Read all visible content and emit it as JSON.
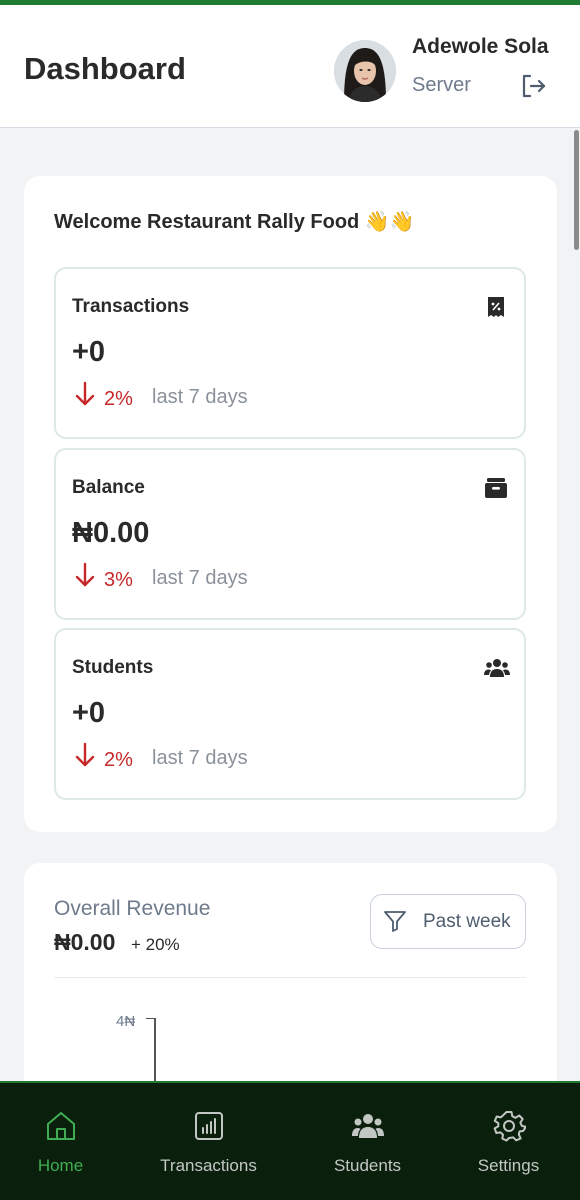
{
  "header": {
    "title": "Dashboard",
    "user_name": "Adewole Sola",
    "user_role": "Server"
  },
  "welcome": {
    "text": "Welcome Restaurant Rally Food 👋👋"
  },
  "stats": [
    {
      "title": "Transactions",
      "value": "+0",
      "change": "2%",
      "period": "last 7 days",
      "icon": "receipt-icon"
    },
    {
      "title": "Balance",
      "value": "₦0.00",
      "change": "3%",
      "period": "last 7 days",
      "icon": "wallet-icon"
    },
    {
      "title": "Students",
      "value": "+0",
      "change": "2%",
      "period": "last 7 days",
      "icon": "users-icon"
    }
  ],
  "revenue": {
    "title": "Overall Revenue",
    "value": "₦0.00",
    "change": "+ 20%",
    "filter_label": "Past week",
    "y_tick": "4₦"
  },
  "nav": [
    {
      "label": "Home",
      "icon": "home-icon",
      "active": true
    },
    {
      "label": "Transactions",
      "icon": "chart-icon",
      "active": false
    },
    {
      "label": "Students",
      "icon": "users-icon",
      "active": false
    },
    {
      "label": "Settings",
      "icon": "gear-icon",
      "active": false
    }
  ],
  "colors": {
    "brand_green": "#1f7a32",
    "nav_background": "#0a200d",
    "negative_red": "#c62828"
  }
}
